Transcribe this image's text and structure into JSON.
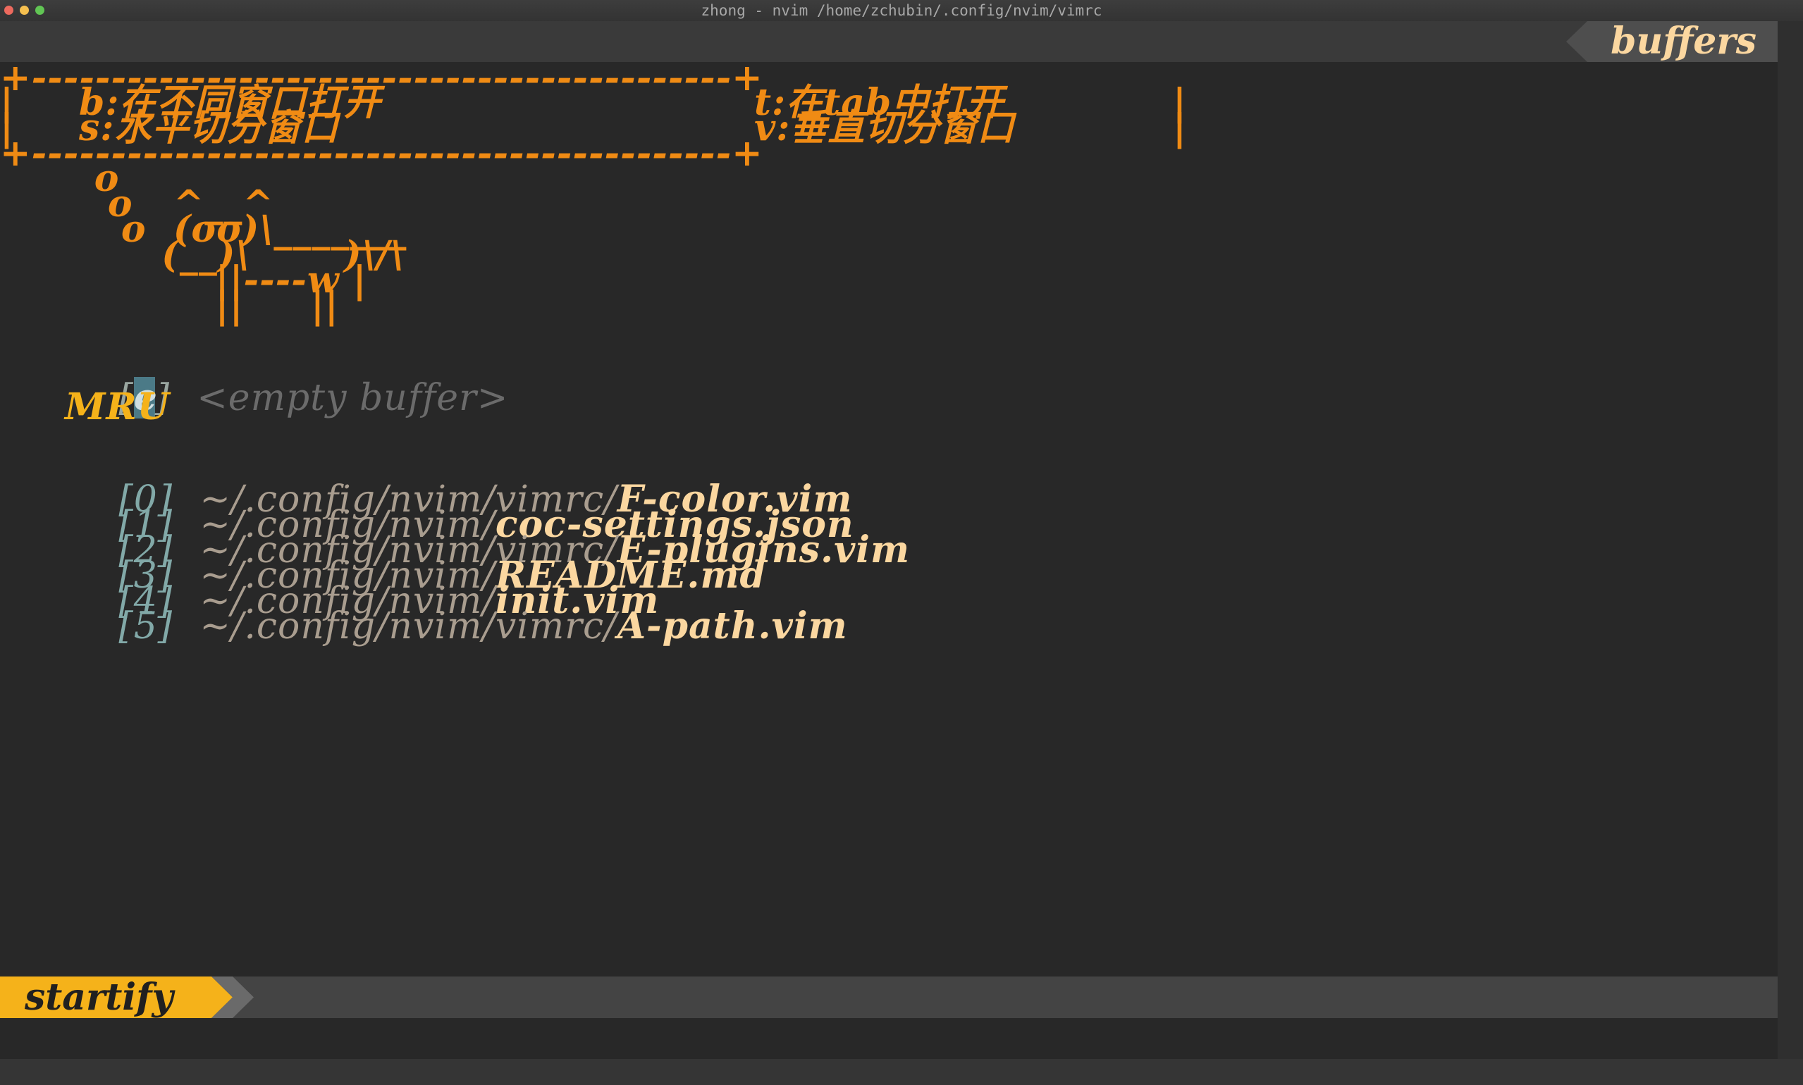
{
  "window": {
    "title": "zhong - nvim /home/zchubin/.config/nvim/vimrc"
  },
  "tabline": {
    "label": "buffers"
  },
  "header": {
    "border": "+--------------------------------------------+",
    "row1_bar_left": "|",
    "row1_left": "b:在不同窗口打开",
    "row1_right": "t:在tab中打开",
    "row1_bar_right": "|",
    "row2_bar_left": "|",
    "row2_left": "s:水平切分窗口",
    "row2_right": "v:垂直切分窗口",
    "row2_bar_right": "|",
    "cow": [
      "       o",
      "        o   ^__^",
      "         o  (oo)\\_______",
      "            (__)\\       )\\/\\",
      "                ||----w |",
      "                ||     ||"
    ]
  },
  "empty_buffer": {
    "open_bracket": "[",
    "key": "e",
    "close_bracket": "]",
    "label": "<empty buffer>"
  },
  "mru": {
    "heading": "MRU",
    "items": [
      {
        "index": "[0]",
        "dir": "~/.config/nvim/vimrc/",
        "file": "F-color.vim"
      },
      {
        "index": "[1]",
        "dir": "~/.config/nvim/",
        "file": "coc-settings.json"
      },
      {
        "index": "[2]",
        "dir": "~/.config/nvim/vimrc/",
        "file": "E-plugins.vim"
      },
      {
        "index": "[3]",
        "dir": "~/.config/nvim/",
        "file": "README.md"
      },
      {
        "index": "[4]",
        "dir": "~/.config/nvim/",
        "file": "init.vim"
      },
      {
        "index": "[5]",
        "dir": "~/.config/nvim/vimrc/",
        "file": "A-path.vim"
      }
    ]
  },
  "statusline": {
    "mode": "startify"
  },
  "colors": {
    "background": "#282828",
    "accent_orange": "#f08b14",
    "mode_yellow": "#f5b21a",
    "filename": "#fbd7a0",
    "directory": "#a99d8f",
    "index": "#82a9a8"
  }
}
